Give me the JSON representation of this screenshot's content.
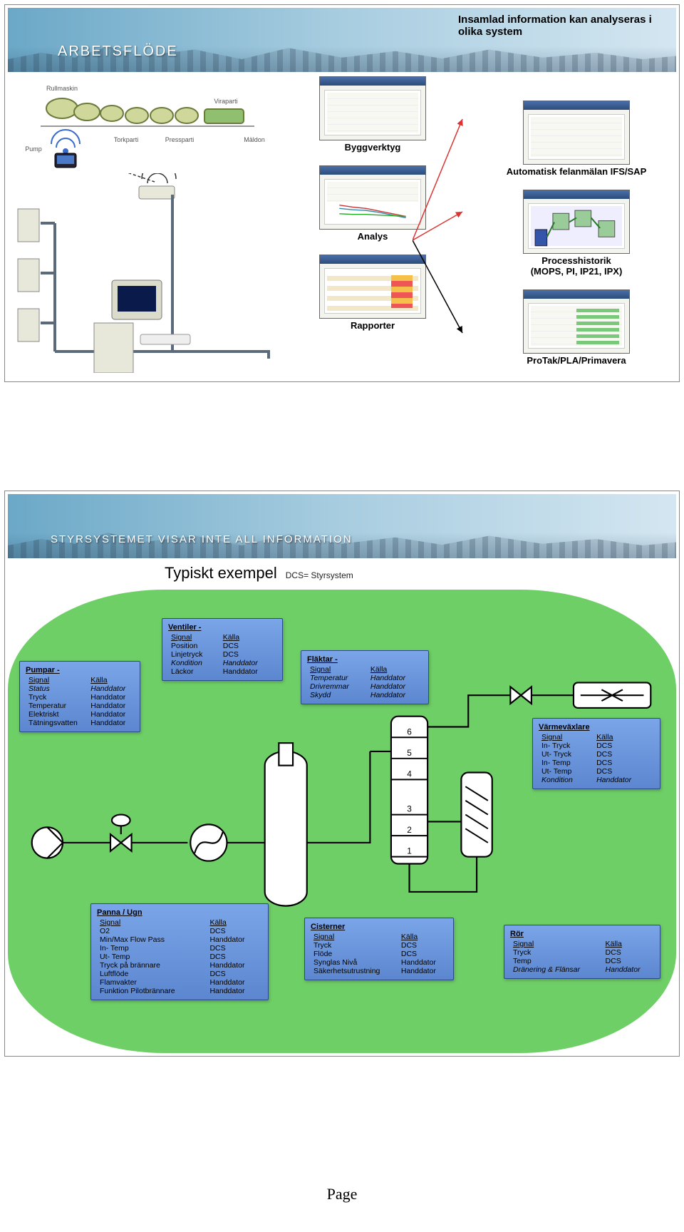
{
  "top": {
    "banner_title": "Arbetsflöde",
    "info_text": "Insamlad information kan analyseras i olika system",
    "mid_labels": {
      "byggverktyg": "Byggverktyg",
      "analys": "Analys",
      "rapporter": "Rapporter"
    },
    "right_labels": {
      "auto_fel": "Automatisk felanmälan IFS/SAP",
      "process_hist": "Processhistorik\n(MOPS, PI, IP21, IPX)",
      "protak": "ProTak/PLA/Primavera"
    },
    "mill_labels": {
      "rullmaskin": "Rullmaskin",
      "torkparti": "Torkparti",
      "pressparti": "Pressparti",
      "viraparti": "Viraparti",
      "maldon": "Mäldon",
      "pump": "Pump"
    }
  },
  "bottom": {
    "banner_title": "Styrsystemet visar inte all information",
    "example_title": "Typiskt exempel",
    "example_sub": "DCS= Styrsystem",
    "column_numbers": [
      "6",
      "5",
      "4",
      "3",
      "2",
      "1"
    ],
    "boxes": {
      "pumpar": {
        "title": "Pumpar -",
        "rows": [
          [
            "Signal",
            "Källa",
            "u"
          ],
          [
            "Status",
            "Handdator",
            "i"
          ],
          [
            "Tryck",
            "Handdator",
            ""
          ],
          [
            "Temperatur",
            "Handdator",
            ""
          ],
          [
            "Elektriskt",
            "Handdator",
            ""
          ],
          [
            "Tätningsvatten",
            "Handdator",
            ""
          ]
        ]
      },
      "ventiler": {
        "title": "Ventiler -",
        "rows": [
          [
            "Signal",
            "Källa",
            "u"
          ],
          [
            "Position",
            "DCS",
            ""
          ],
          [
            "Linjetryck",
            "DCS",
            ""
          ],
          [
            "Kondition",
            "Handdator",
            "i"
          ],
          [
            "Läckor",
            "Handdator",
            ""
          ]
        ]
      },
      "flaktar": {
        "title": "Fläktar -",
        "rows": [
          [
            "Signal",
            "Källa",
            "u"
          ],
          [
            "Temperatur",
            "Handdator",
            "i"
          ],
          [
            "Drivremmar",
            "Handdator",
            "i"
          ],
          [
            "Skydd",
            "Handdator",
            "i"
          ]
        ]
      },
      "varmevaxlare": {
        "title": "Värmeväxlare",
        "rows": [
          [
            "Signal",
            "Källa",
            "u"
          ],
          [
            "In- Tryck",
            "DCS",
            ""
          ],
          [
            "Ut- Tryck",
            "DCS",
            ""
          ],
          [
            "In- Temp",
            "DCS",
            ""
          ],
          [
            "Ut- Temp",
            "DCS",
            ""
          ],
          [
            "Kondition",
            "Handdator",
            "i"
          ]
        ]
      },
      "panna": {
        "title": "Panna / Ugn",
        "rows": [
          [
            "Signal",
            "Källa",
            "u"
          ],
          [
            "O2",
            "DCS",
            ""
          ],
          [
            "Min/Max Flow Pass",
            "Handdator",
            ""
          ],
          [
            "In- Temp",
            "DCS",
            ""
          ],
          [
            "Ut- Temp",
            "DCS",
            ""
          ],
          [
            "Tryck på brännare",
            "Handdator",
            ""
          ],
          [
            "Luftflöde",
            "DCS",
            ""
          ],
          [
            "Flamvakter",
            "Handdator",
            ""
          ],
          [
            "Funktion Pilotbrännare",
            "Handdator",
            ""
          ]
        ]
      },
      "cisterner": {
        "title": "Cisterner",
        "rows": [
          [
            "Signal",
            "Källa",
            "u"
          ],
          [
            "Tryck",
            "DCS",
            ""
          ],
          [
            "Flöde",
            "DCS",
            ""
          ],
          [
            "Synglas Nivå",
            "Handdator",
            ""
          ],
          [
            "Säkerhetsutrustning",
            "Handdator",
            ""
          ]
        ]
      },
      "ror": {
        "title": "Rör",
        "rows": [
          [
            "Signal",
            "Källa",
            "u"
          ],
          [
            "Tryck",
            "DCS",
            ""
          ],
          [
            "Temp",
            "DCS",
            ""
          ],
          [
            "Dränering & Flänsar",
            "Handdator",
            "i"
          ]
        ]
      }
    }
  },
  "page_footer": "Page"
}
